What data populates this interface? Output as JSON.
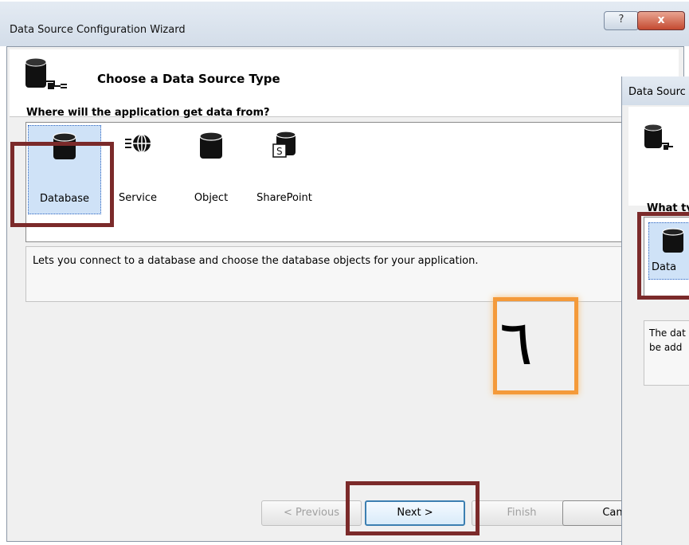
{
  "window": {
    "title": "Data Source Configuration Wizard",
    "help_label": "?",
    "close_label": "x"
  },
  "header": {
    "title": "Choose a Data Source Type",
    "icon": "database-connect-icon"
  },
  "question": "Where will the application get data from?",
  "sources": [
    {
      "label": "Database",
      "icon": "database-icon",
      "selected": true
    },
    {
      "label": "Service",
      "icon": "web-service-icon",
      "selected": false
    },
    {
      "label": "Object",
      "icon": "object-icon",
      "selected": false
    },
    {
      "label": "SharePoint",
      "icon": "sharepoint-icon",
      "selected": false
    }
  ],
  "description": "Lets you connect to a database and choose the database objects for your application.",
  "step_number": "٦",
  "buttons": {
    "previous": "< Previous",
    "next": "Next >",
    "finish": "Finish",
    "cancel": "Can"
  },
  "second_window": {
    "title": "Data Sourc",
    "question": "What ty",
    "item_label": "Data",
    "desc_line1": "The dat",
    "desc_line2": "be add"
  },
  "colors": {
    "highlight": "#7b2a2a",
    "step_highlight": "#f49a3a",
    "selection": "#cfe2f7"
  }
}
